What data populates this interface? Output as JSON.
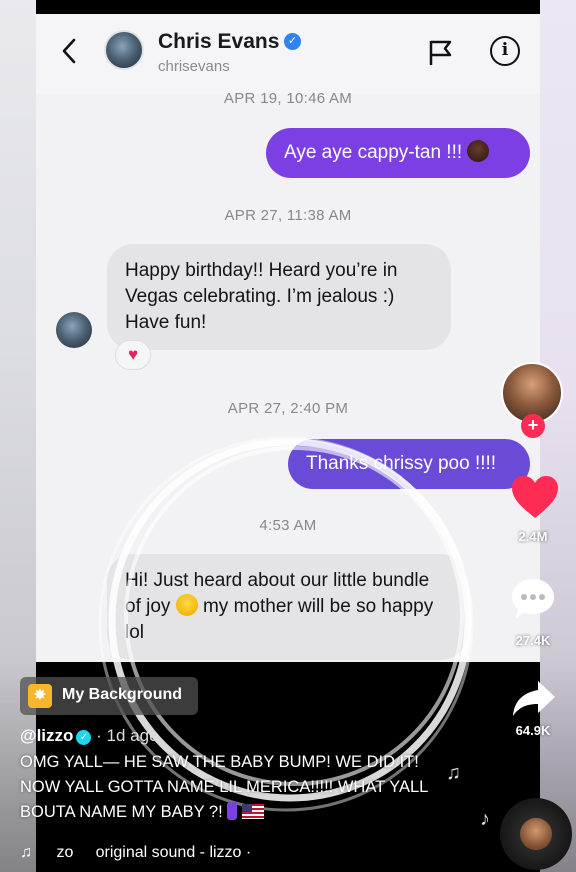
{
  "chat": {
    "name": "Chris Evans",
    "handle": "chrisevans",
    "messages": [
      {
        "kind": "timestamp",
        "text": "APR 19, 10:46 AM"
      },
      {
        "kind": "outgoing",
        "text": "Aye aye cappy-tan !!!"
      },
      {
        "kind": "timestamp",
        "text": "APR 27, 11:38 AM"
      },
      {
        "kind": "incoming",
        "text": "Happy birthday!! Heard you’re in Vegas celebrating. I’m jealous :) Have fun!",
        "reaction": "heart"
      },
      {
        "kind": "timestamp",
        "text": "APR 27, 2:40 PM"
      },
      {
        "kind": "outgoing",
        "text": "Thanks chrissy poo !!!!"
      },
      {
        "kind": "timestamp",
        "text": "4:53 AM"
      },
      {
        "kind": "incoming",
        "text_before_emoji": "Hi! Just heard about our little bundle of joy",
        "text_after_emoji": "my mother will be so happy lol"
      }
    ]
  },
  "rail": {
    "likes": "2.4M",
    "comments": "27.4K",
    "shares": "64.9K"
  },
  "caption": {
    "background_label": "My Background",
    "username": "@lizzo",
    "age": "· 1d ago",
    "text": "OMG YALL— HE SAW THE BABY BUMP! WE DID IT! NOW YALL GOTTA NAME LIL MERICA!!!!! WHAT YALL BOUTA NAME MY BABY ?!",
    "sound_prefix": "zo",
    "sound_name": "original sound - lizzo ·"
  },
  "colors": {
    "outgoing_bubble": "#7b3fe4",
    "incoming_bubble": "#e4e4e6",
    "like": "#fe2c55"
  },
  "icons": [
    "back-arrow-icon",
    "verified-icon",
    "flag-icon",
    "info-icon",
    "heart-icon",
    "comment-icon",
    "share-icon",
    "music-note-icon"
  ]
}
